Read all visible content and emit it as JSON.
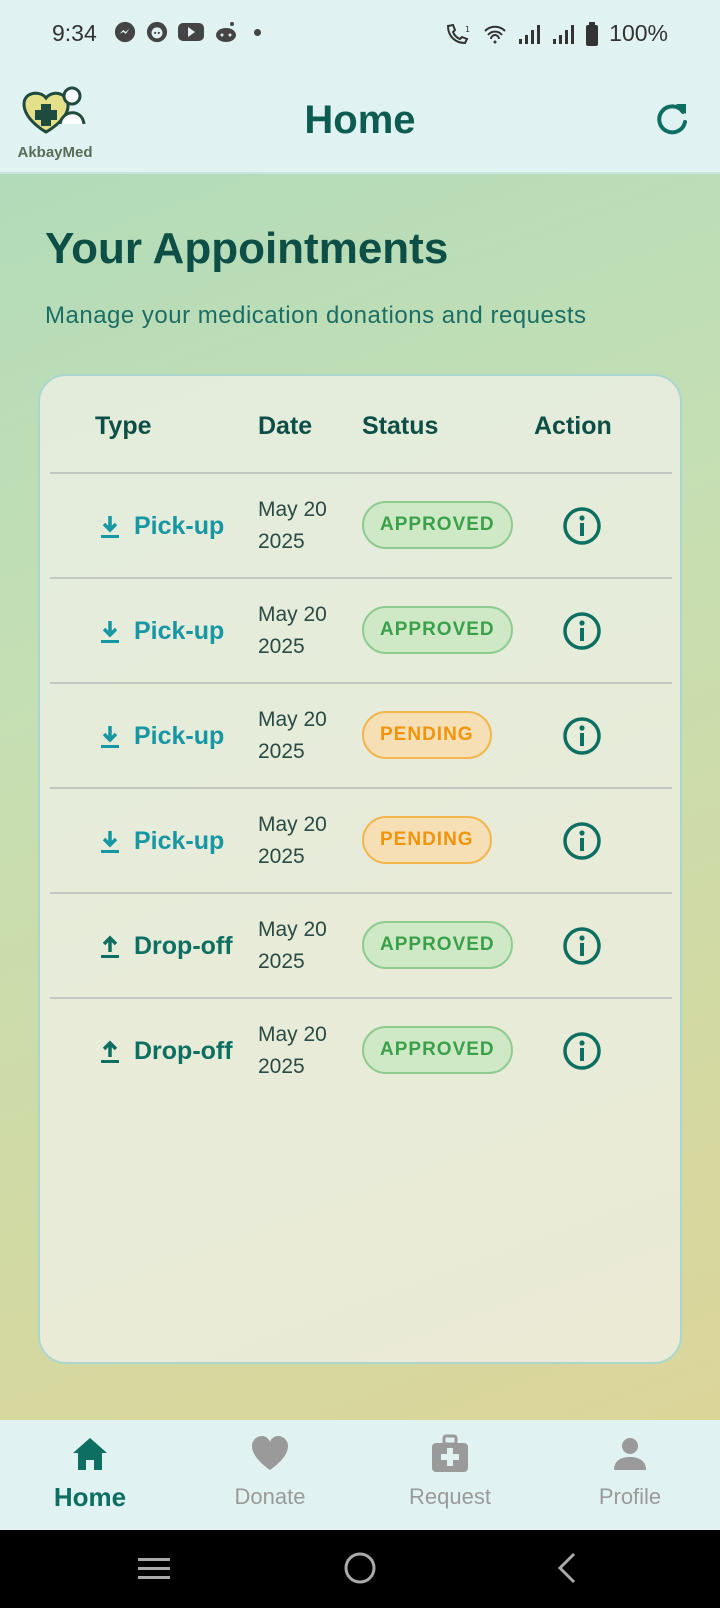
{
  "status_bar": {
    "time": "9:34",
    "battery": "100%",
    "left_icons": [
      "messenger-icon",
      "reddit-icon",
      "youtube-icon",
      "reddit-alien-icon"
    ],
    "right_icons": [
      "wifi-call-icon",
      "wifi-icon",
      "signal-icon",
      "signal-icon",
      "battery-icon"
    ]
  },
  "app_bar": {
    "logo_text": "AkbayMed",
    "title": "Home",
    "refresh_icon": "refresh-icon"
  },
  "main": {
    "heading": "Your Appointments",
    "subheading": "Manage your medication donations and requests",
    "table": {
      "headers": [
        "Type",
        "Date",
        "Status",
        "Action"
      ],
      "rows": [
        {
          "type": "Pick-up",
          "kind": "pickup",
          "date_line1": "May 20",
          "date_line2": "2025",
          "status": "APPROVED"
        },
        {
          "type": "Pick-up",
          "kind": "pickup",
          "date_line1": "May 20",
          "date_line2": "2025",
          "status": "APPROVED"
        },
        {
          "type": "Pick-up",
          "kind": "pickup",
          "date_line1": "May 20",
          "date_line2": "2025",
          "status": "PENDING"
        },
        {
          "type": "Pick-up",
          "kind": "pickup",
          "date_line1": "May 20",
          "date_line2": "2025",
          "status": "PENDING"
        },
        {
          "type": "Drop-off",
          "kind": "dropoff",
          "date_line1": "May 20",
          "date_line2": "2025",
          "status": "APPROVED"
        },
        {
          "type": "Drop-off",
          "kind": "dropoff",
          "date_line1": "May 20",
          "date_line2": "2025",
          "status": "APPROVED"
        }
      ]
    }
  },
  "bottom_nav": {
    "items": [
      {
        "label": "Home",
        "icon": "home-icon",
        "active": true
      },
      {
        "label": "Donate",
        "icon": "heart-icon",
        "active": false
      },
      {
        "label": "Request",
        "icon": "medical-kit-icon",
        "active": false
      },
      {
        "label": "Profile",
        "icon": "person-icon",
        "active": false
      }
    ]
  },
  "colors": {
    "primary": "#0d6f62",
    "pickup": "#1796a3",
    "approved": "#3aa14a",
    "pending": "#f0940a"
  }
}
